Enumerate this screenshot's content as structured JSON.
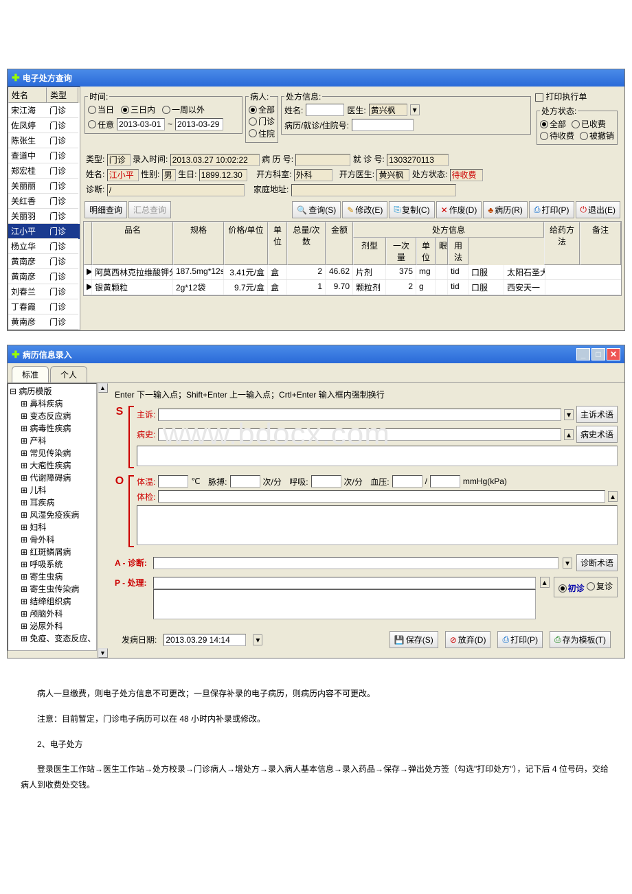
{
  "query_window": {
    "title": "电子处方查询",
    "list_header": {
      "name": "姓名",
      "type": "类型"
    },
    "patients": [
      {
        "name": "宋江海",
        "type": "门诊"
      },
      {
        "name": "佐凤婷",
        "type": "门诊"
      },
      {
        "name": "陈张生",
        "type": "门诊"
      },
      {
        "name": "查道中",
        "type": "门诊"
      },
      {
        "name": "郑宏桂",
        "type": "门诊"
      },
      {
        "name": "关丽丽",
        "type": "门诊"
      },
      {
        "name": "关红香",
        "type": "门诊"
      },
      {
        "name": "关丽羽",
        "type": "门诊"
      },
      {
        "name": "江小平",
        "type": "门诊"
      },
      {
        "name": "杨立华",
        "type": "门诊"
      },
      {
        "name": "黄南彦",
        "type": "门诊"
      },
      {
        "name": "黄南彦",
        "type": "门诊"
      },
      {
        "name": "刘春兰",
        "type": "门诊"
      },
      {
        "name": "丁春霞",
        "type": "门诊"
      },
      {
        "name": "黄南彦",
        "type": "门诊"
      }
    ],
    "selected_index": 8,
    "filter": {
      "time_label": "时间:",
      "today": "当日",
      "three_day": "三日内",
      "one_week": "一周以外",
      "any": "任意",
      "date_from": "2013-03-01",
      "date_to": "2013-03-29",
      "patient_label": "病人:",
      "all": "全部",
      "out": "门诊",
      "in": "住院",
      "rx_info": "处方信息:",
      "name_label": "姓名:",
      "doctor_label": "医生:",
      "doctor_value": "黄兴枫",
      "record_no_label": "病历/就诊/住院号:",
      "print_exec": "打印执行单",
      "rx_status": "处方状态:",
      "status_all": "全部",
      "status_charged": "已收费",
      "status_pending": "待收费",
      "status_cancel": "被撤销"
    },
    "detail": {
      "type_label": "类型:",
      "type": "门诊",
      "entry_time_label": "录入时间:",
      "entry_time": "2013.03.27 10:02:22",
      "record_label": "病 历 号:",
      "visit_no_label": "就 诊 号:",
      "visit_no": "1303270113",
      "name_label": "姓名:",
      "name": "江小平",
      "sex_label": "性别:",
      "sex": "男",
      "birth_label": "生日:",
      "birth": "1899.12.30",
      "dept_label": "开方科室:",
      "dept": "外科",
      "doctor_label": "开方医生:",
      "doctor": "黄兴枫",
      "status_label": "处方状态:",
      "status": "待收费",
      "diag_label": "诊断:",
      "diag": "/",
      "addr_label": "家庭地址:"
    },
    "toolbar": {
      "detail": "明细查询",
      "summary": "汇总查询",
      "query": "查询(S)",
      "modify": "修改(E)",
      "copy": "复制(C)",
      "cancel": "作废(D)",
      "record": "病历(R)",
      "print": "打印(P)",
      "exit": "退出(E)"
    },
    "grid_head": {
      "name": "品名",
      "spec": "规格",
      "price": "价格/单位",
      "unit": "单位",
      "qty": "总量/次数",
      "amount": "金额",
      "rx_info": "处方信息",
      "form": "剂型",
      "dose": "一次量",
      "dose_unit": "单位",
      "ny": "眼",
      "usage": "用法",
      "method": "给药方法",
      "remark": "备注"
    },
    "grid_rows": [
      {
        "name": "阿莫西林克拉维酸钾分",
        "spec": "187.5mg*12s",
        "price": "3.41元/盒",
        "unit": "盒",
        "qty": "2",
        "amount": "46.62",
        "form": "片剂",
        "dose": "375",
        "dose_unit": "mg",
        "usage": "tid",
        "method": "口服",
        "remark": "太阳石圣大"
      },
      {
        "name": "银黄颗粒",
        "spec": "2g*12袋",
        "price": "9.7元/盒",
        "unit": "盒",
        "qty": "1",
        "amount": "9.70",
        "form": "颗粒剂",
        "dose": "2",
        "dose_unit": "g",
        "usage": "tid",
        "method": "口服",
        "remark": "西安天一"
      }
    ]
  },
  "record_window": {
    "title": "病历信息录入",
    "tabs": {
      "std": "标准",
      "personal": "个人"
    },
    "tree_root": "病历模版",
    "tree": [
      "鼻科疾病",
      "变态反应病",
      "病毒性疾病",
      "产科",
      "常见传染病",
      "大疱性疾病",
      "代谢障碍病",
      "儿科",
      "耳疾病",
      "风湿免疫疾病",
      "妇科",
      "骨外科",
      "红斑鳞屑病",
      "呼吸系统",
      "寄生虫病",
      "寄生虫传染病",
      "结缔组织病",
      "颅脑外科",
      "泌尿外科",
      "免疫、变态反应、组"
    ],
    "hint": "Enter 下一输入点；Shift+Enter 上一输入点；Crtl+Enter 输入框内强制换行",
    "labels": {
      "chief": "主诉:",
      "history": "病史:",
      "temp": "体温:",
      "c": "℃",
      "pulse": "脉搏:",
      "per_min": "次/分",
      "resp": "呼吸:",
      "bp": "血压:",
      "bp_unit": "mmHg(kPa)",
      "exam": "体检:",
      "diag": "A - 诊断:",
      "plan": "P - 处理:",
      "onset": "发病日期:"
    },
    "onset_date": "2013.03.29 14:14",
    "side_buttons": {
      "chief": "主诉术语",
      "history": "病史术语",
      "diag": "诊断术语"
    },
    "visit": {
      "first": "初诊",
      "return": "复诊"
    },
    "actions": {
      "save": "保存(S)",
      "discard": "放弃(D)",
      "print": "打印(P)",
      "save_tpl": "存为模板(T)"
    },
    "watermark": "www.bdocx.com"
  },
  "doc": {
    "p1": "病人一旦缴费，则电子处方信息不可更改；一旦保存补录的电子病历，则病历内容不可更改。",
    "p2": "注意：目前暂定，门诊电子病历可以在 48 小时内补录或修改。",
    "p3": "2、电子处方",
    "p4": "登录医生工作站→医生工作站→处方校录→门诊病人→增处方→录入病人基本信息→录入药品→保存→弹出处方签（勾选\"打印处方\"），记下后 4 位号码，交给病人到收费处交钱。"
  }
}
